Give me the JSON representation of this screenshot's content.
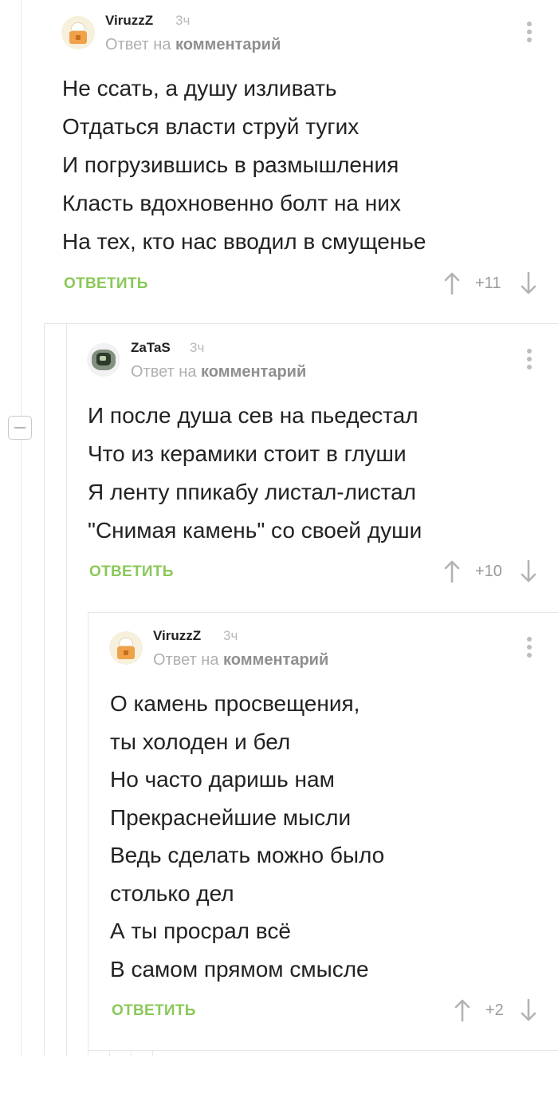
{
  "comments": [
    {
      "author": "ViruzzZ",
      "time": "3ч",
      "reply_prefix": "Ответ на",
      "reply_link": "комментарий",
      "lines": [
        "Не ссать, а душу изливать",
        "Отдаться власти струй тугих",
        "И погрузившись в размышления",
        "Класть вдохновенно болт на них",
        "На тех, кто нас вводил в смущенье"
      ],
      "reply_label": "ОТВЕТИТЬ",
      "rating": "+11"
    },
    {
      "author": "ZaTaS",
      "time": "3ч",
      "reply_prefix": "Ответ на",
      "reply_link": "комментарий",
      "lines": [
        "И после душа сев на пьедестал",
        "Что из керамики стоит в глуши",
        "Я ленту ппикабу листал-листал",
        "\"Снимая камень\" со своей души"
      ],
      "reply_label": "ОТВЕТИТЬ",
      "rating": "+10"
    },
    {
      "author": "ViruzzZ",
      "time": "3ч",
      "reply_prefix": "Ответ на",
      "reply_link": "комментарий",
      "lines": [
        "О камень просвещения,",
        "ты холоден и бел",
        "Но часто даришь нам",
        "Прекраснейшие мысли",
        "Ведь сделать можно было",
        "столько дел",
        "А ты просрал всё",
        "В самом прямом смысле"
      ],
      "reply_label": "ОТВЕТИТЬ",
      "rating": "+2"
    }
  ],
  "icons": {
    "upvote": "arrow-up-icon",
    "downvote": "arrow-down-icon",
    "more": "more-vertical-icon",
    "collapse": "collapse-minus-icon"
  },
  "colors": {
    "accent_green": "#8ac858",
    "thread_line": "#e6e6e6",
    "muted_text": "#b0b0b0"
  }
}
